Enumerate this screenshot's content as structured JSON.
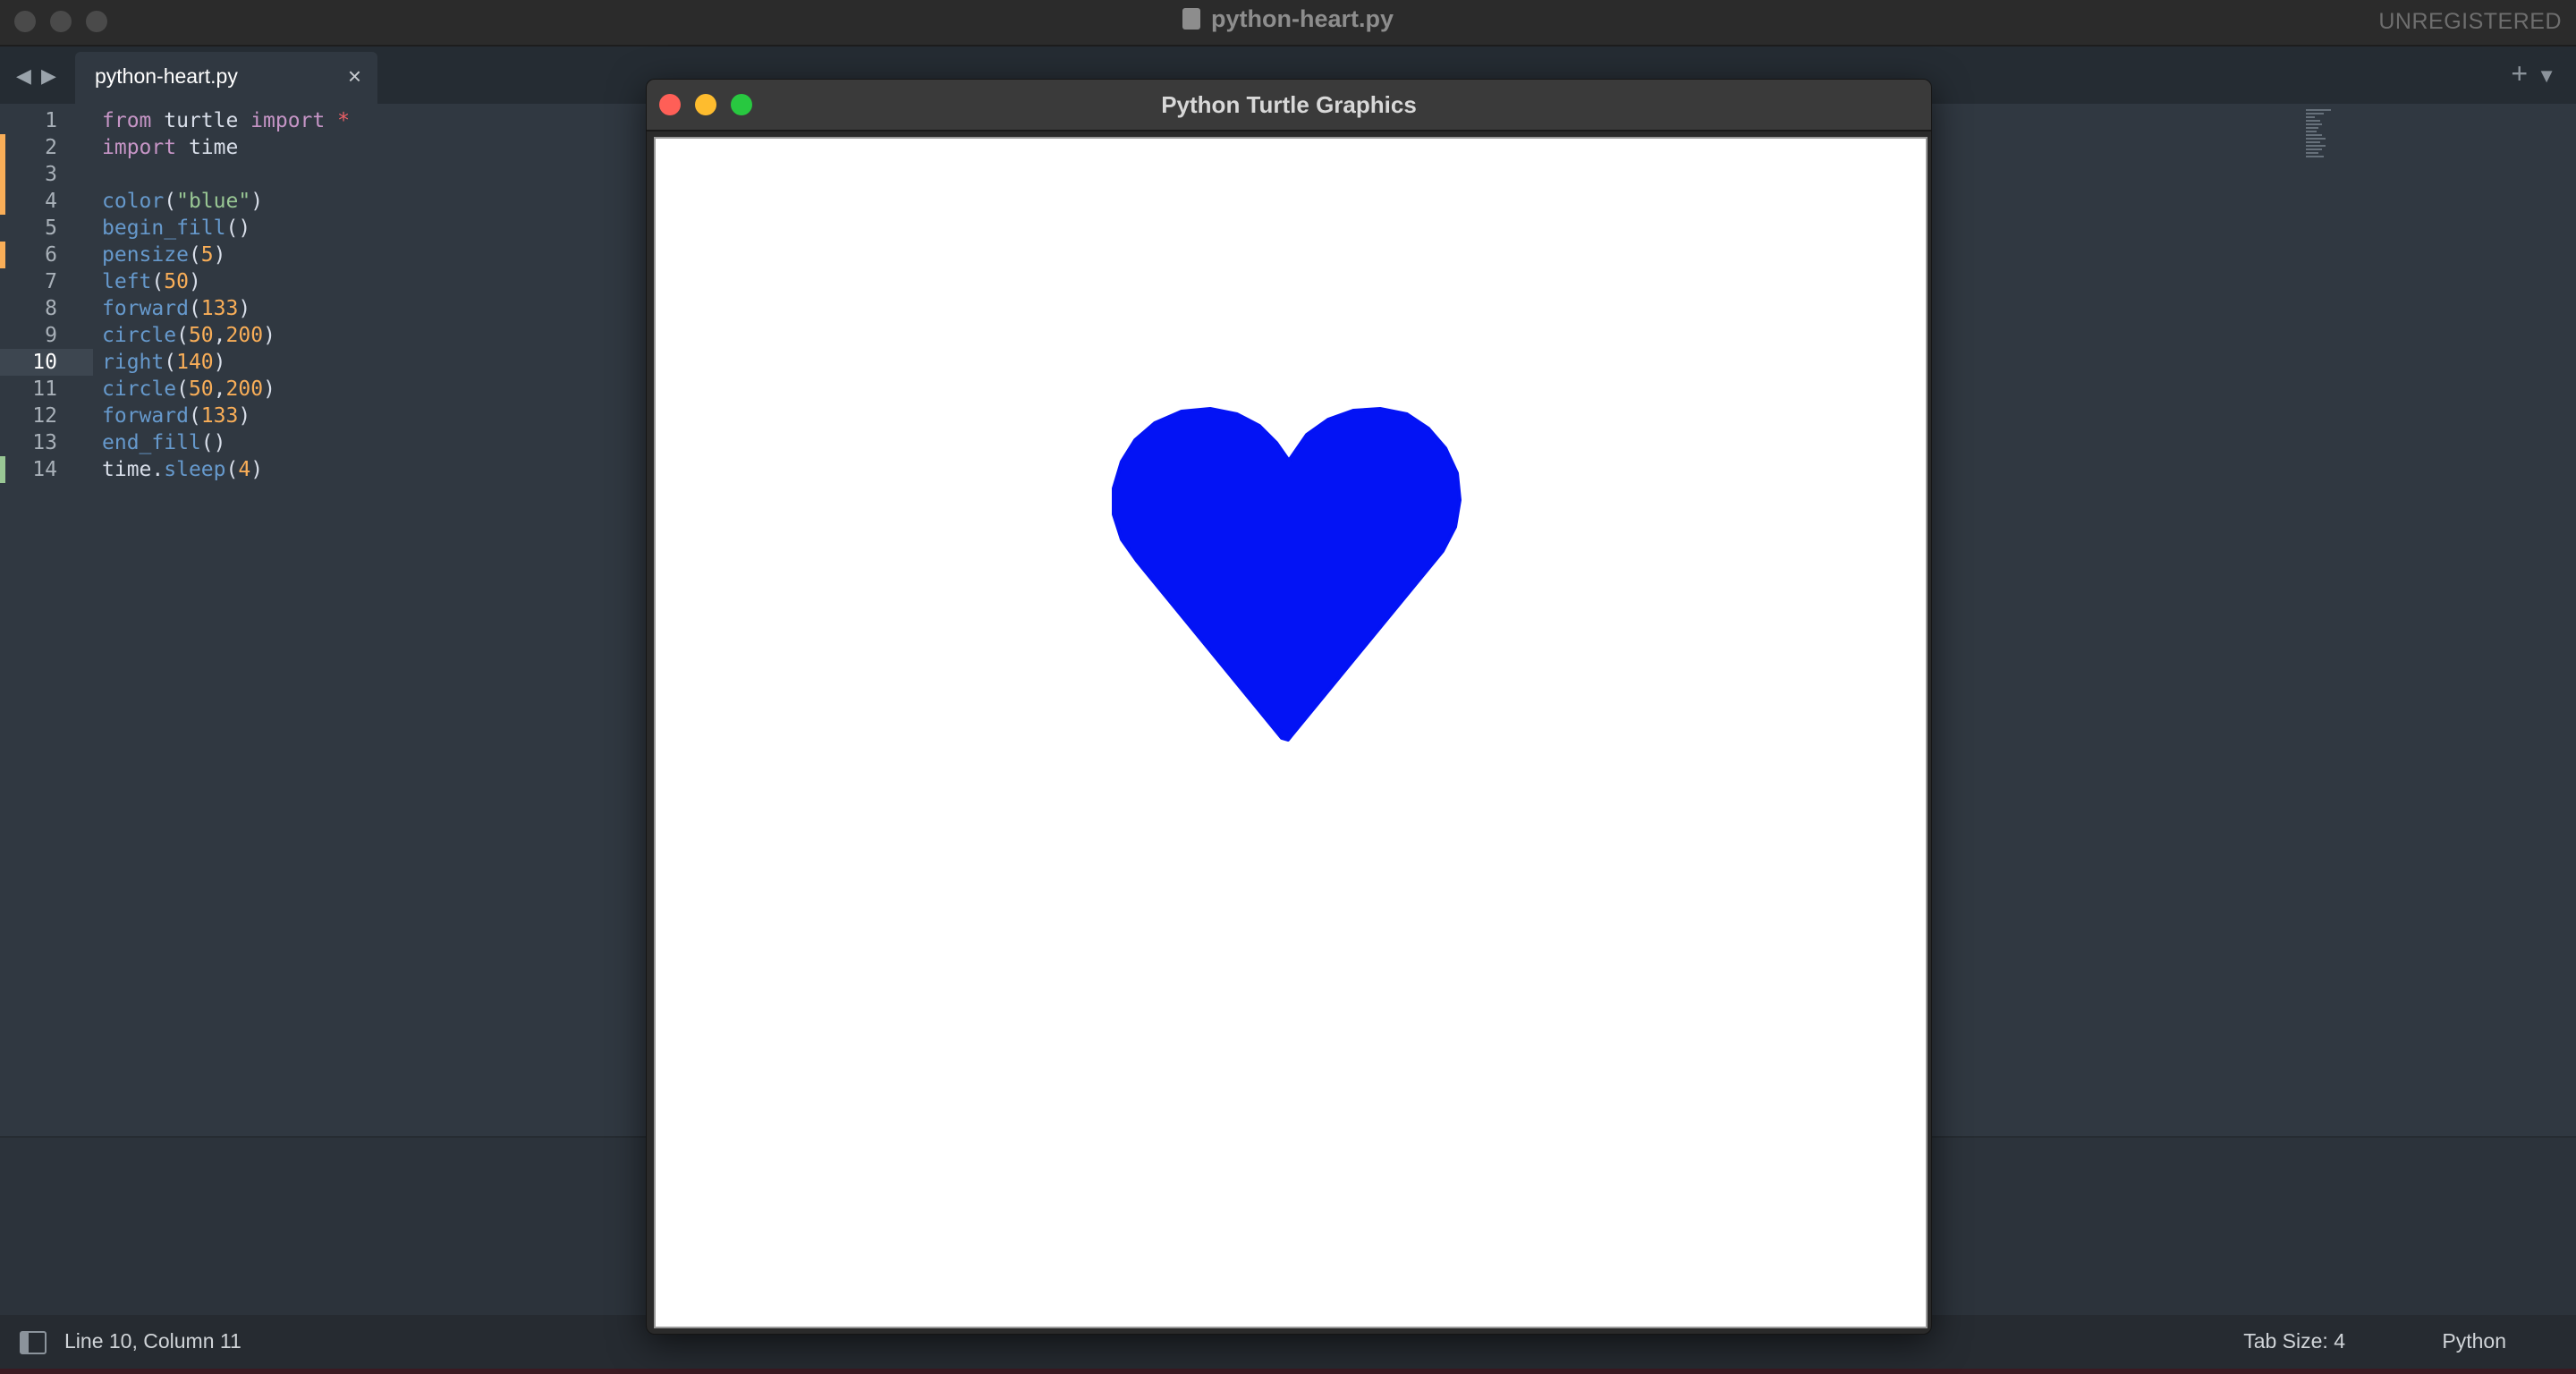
{
  "editor_window": {
    "title": "python-heart.py",
    "license": "UNREGISTERED"
  },
  "tabs": [
    {
      "label": "python-heart.py",
      "close": "×"
    }
  ],
  "tabbar": {
    "back": "◀",
    "forward": "▶",
    "add": "+",
    "menu": "▼"
  },
  "code": {
    "current_line": 10,
    "lines": [
      {
        "n": "1",
        "tokens": [
          {
            "t": "from",
            "c": "kw"
          },
          {
            "t": " turtle ",
            "c": "pl"
          },
          {
            "t": "import",
            "c": "kw"
          },
          {
            "t": " ",
            "c": "pl"
          },
          {
            "t": "*",
            "c": "op"
          }
        ]
      },
      {
        "n": "2",
        "tokens": [
          {
            "t": "import",
            "c": "kw"
          },
          {
            "t": " time",
            "c": "pl"
          }
        ]
      },
      {
        "n": "3",
        "tokens": []
      },
      {
        "n": "4",
        "tokens": [
          {
            "t": "color",
            "c": "fn"
          },
          {
            "t": "(",
            "c": "pl"
          },
          {
            "t": "\"blue\"",
            "c": "str"
          },
          {
            "t": ")",
            "c": "pl"
          }
        ]
      },
      {
        "n": "5",
        "tokens": [
          {
            "t": "begin_fill",
            "c": "fn"
          },
          {
            "t": "()",
            "c": "pl"
          }
        ]
      },
      {
        "n": "6",
        "tokens": [
          {
            "t": "pensize",
            "c": "fn"
          },
          {
            "t": "(",
            "c": "pl"
          },
          {
            "t": "5",
            "c": "num"
          },
          {
            "t": ")",
            "c": "pl"
          }
        ]
      },
      {
        "n": "7",
        "tokens": [
          {
            "t": "left",
            "c": "fn"
          },
          {
            "t": "(",
            "c": "pl"
          },
          {
            "t": "50",
            "c": "num"
          },
          {
            "t": ")",
            "c": "pl"
          }
        ]
      },
      {
        "n": "8",
        "tokens": [
          {
            "t": "forward",
            "c": "fn"
          },
          {
            "t": "(",
            "c": "pl"
          },
          {
            "t": "133",
            "c": "num"
          },
          {
            "t": ")",
            "c": "pl"
          }
        ]
      },
      {
        "n": "9",
        "tokens": [
          {
            "t": "circle",
            "c": "fn"
          },
          {
            "t": "(",
            "c": "pl"
          },
          {
            "t": "50",
            "c": "num"
          },
          {
            "t": ",",
            "c": "pl"
          },
          {
            "t": "200",
            "c": "num"
          },
          {
            "t": ")",
            "c": "pl"
          }
        ]
      },
      {
        "n": "10",
        "tokens": [
          {
            "t": "right",
            "c": "fn"
          },
          {
            "t": "(",
            "c": "pl"
          },
          {
            "t": "140",
            "c": "num"
          },
          {
            "t": ")",
            "c": "pl"
          }
        ]
      },
      {
        "n": "11",
        "tokens": [
          {
            "t": "circle",
            "c": "fn"
          },
          {
            "t": "(",
            "c": "pl"
          },
          {
            "t": "50",
            "c": "num"
          },
          {
            "t": ",",
            "c": "pl"
          },
          {
            "t": "200",
            "c": "num"
          },
          {
            "t": ")",
            "c": "pl"
          }
        ]
      },
      {
        "n": "12",
        "tokens": [
          {
            "t": "forward",
            "c": "fn"
          },
          {
            "t": "(",
            "c": "pl"
          },
          {
            "t": "133",
            "c": "num"
          },
          {
            "t": ")",
            "c": "pl"
          }
        ]
      },
      {
        "n": "13",
        "tokens": [
          {
            "t": "end_fill",
            "c": "fn"
          },
          {
            "t": "()",
            "c": "pl"
          }
        ]
      },
      {
        "n": "14",
        "tokens": [
          {
            "t": "time",
            "c": "pl"
          },
          {
            "t": ".",
            "c": "pl"
          },
          {
            "t": "sleep",
            "c": "fn"
          },
          {
            "t": "(",
            "c": "pl"
          },
          {
            "t": "4",
            "c": "num"
          },
          {
            "t": ")",
            "c": "pl"
          }
        ]
      }
    ]
  },
  "turtle_window": {
    "title": "Python Turtle Graphics",
    "shape": "heart",
    "fill_color": "#0313f5"
  },
  "status": {
    "position": "Line 10, Column 11",
    "tab_size": "Tab Size: 4",
    "syntax": "Python"
  },
  "colors": {
    "keyword": "#c695c6",
    "function": "#6699cc",
    "number": "#f9ae58",
    "string": "#99c794",
    "operator": "#ec5f66",
    "modified_marker": "#f9ae58",
    "added_marker": "#99c794"
  }
}
